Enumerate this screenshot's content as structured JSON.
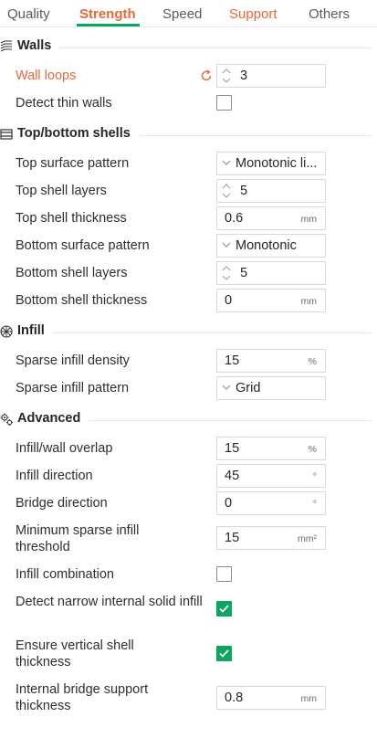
{
  "tabs": [
    "Quality",
    "Strength",
    "Speed",
    "Support",
    "Others"
  ],
  "active_tab": "Strength",
  "colors": {
    "accent": "#e8683a",
    "green": "#0aa55e"
  },
  "sections": {
    "walls": {
      "title": "Walls",
      "icon": "walls-icon",
      "wall_loops": {
        "label": "Wall loops",
        "value": "3"
      },
      "detect_thin_walls": {
        "label": "Detect thin walls",
        "checked": false
      }
    },
    "shells": {
      "title": "Top/bottom shells",
      "icon": "shells-icon",
      "top_surface_pattern": {
        "label": "Top surface pattern",
        "value": "Monotonic li..."
      },
      "top_shell_layers": {
        "label": "Top shell layers",
        "value": "5"
      },
      "top_shell_thickness": {
        "label": "Top shell thickness",
        "value": "0.6",
        "unit": "mm"
      },
      "bottom_surface_pattern": {
        "label": "Bottom surface pattern",
        "value": "Monotonic"
      },
      "bottom_shell_layers": {
        "label": "Bottom shell layers",
        "value": "5"
      },
      "bottom_shell_thickness": {
        "label": "Bottom shell thickness",
        "value": "0",
        "unit": "mm"
      }
    },
    "infill": {
      "title": "Infill",
      "icon": "infill-icon",
      "sparse_infill_density": {
        "label": "Sparse infill density",
        "value": "15",
        "unit": "%"
      },
      "sparse_infill_pattern": {
        "label": "Sparse infill pattern",
        "value": "Grid"
      }
    },
    "advanced": {
      "title": "Advanced",
      "icon": "gears-icon",
      "infill_wall_overlap": {
        "label": "Infill/wall overlap",
        "value": "15",
        "unit": "%"
      },
      "infill_direction": {
        "label": "Infill direction",
        "value": "45",
        "unit": "°"
      },
      "bridge_direction": {
        "label": "Bridge direction",
        "value": "0",
        "unit": "°"
      },
      "min_sparse_infill_threshold": {
        "label": "Minimum sparse infill threshold",
        "value": "15",
        "unit": "mm²"
      },
      "infill_combination": {
        "label": "Infill combination",
        "checked": false
      },
      "detect_narrow_internal_solid_infill": {
        "label": "Detect narrow internal solid infill",
        "checked": true
      },
      "ensure_vertical_shell_thickness": {
        "label": "Ensure vertical shell thickness",
        "checked": true
      },
      "internal_bridge_support_thickness": {
        "label": "Internal bridge support thickness",
        "value": "0.8",
        "unit": "mm"
      }
    }
  }
}
